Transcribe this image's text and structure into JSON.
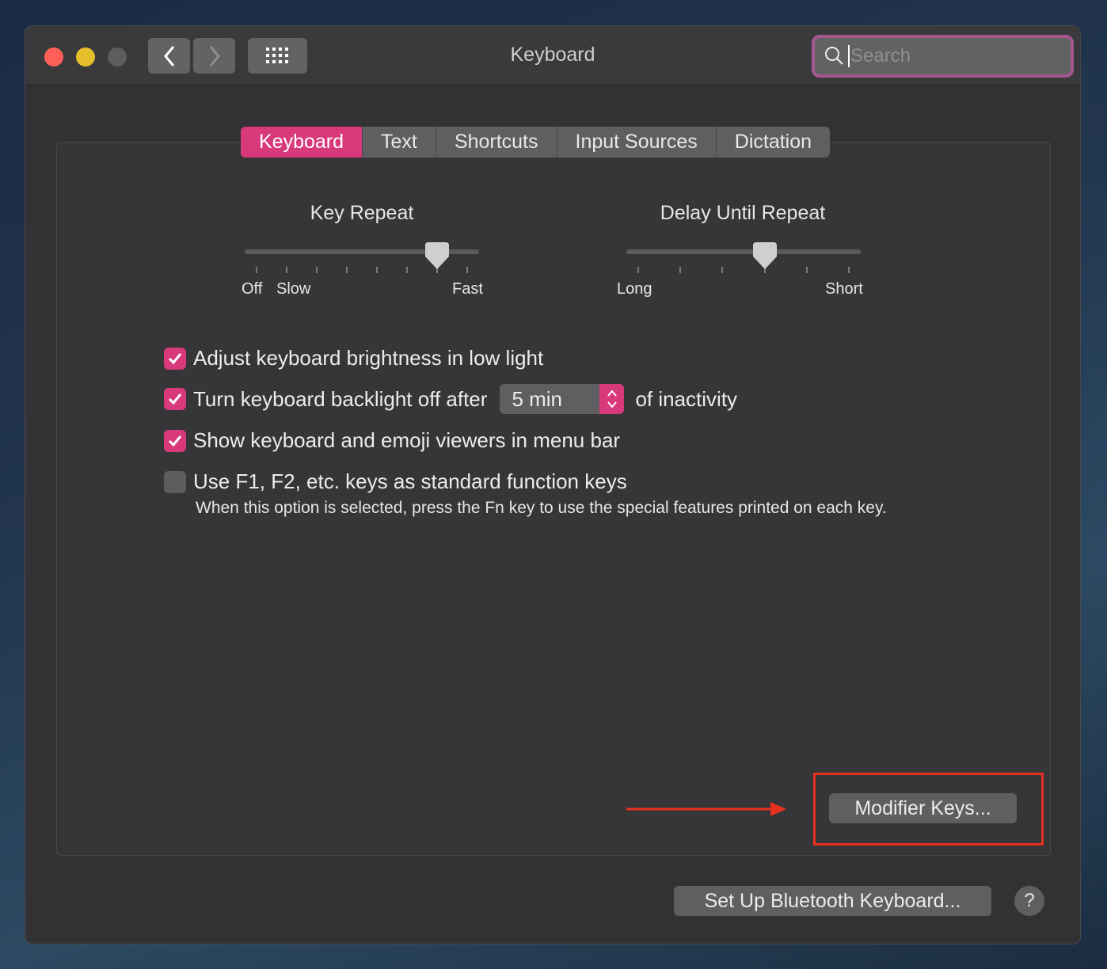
{
  "window": {
    "title": "Keyboard"
  },
  "search": {
    "placeholder": "Search",
    "value": ""
  },
  "tabs": [
    {
      "label": "Keyboard",
      "active": true
    },
    {
      "label": "Text",
      "active": false
    },
    {
      "label": "Shortcuts",
      "active": false
    },
    {
      "label": "Input Sources",
      "active": false
    },
    {
      "label": "Dictation",
      "active": false
    }
  ],
  "key_repeat": {
    "title": "Key Repeat",
    "labels": [
      "Off",
      "Slow",
      "Fast"
    ],
    "ticks": 8,
    "position": 6
  },
  "delay_until_repeat": {
    "title": "Delay Until Repeat",
    "labels": [
      "Long",
      "Short"
    ],
    "ticks": 6,
    "position": 3
  },
  "options": [
    {
      "label": "Adjust keyboard brightness in low light",
      "checked": true
    },
    {
      "label": "Turn keyboard backlight off after",
      "checked": true,
      "popup_value": "5 min",
      "suffix": "of inactivity"
    },
    {
      "label": "Show keyboard and emoji viewers in menu bar",
      "checked": true
    },
    {
      "label": "Use F1, F2, etc. keys as standard function keys",
      "checked": false
    }
  ],
  "fn_note": "When this option is selected, press the Fn key to use the special features printed on each key.",
  "buttons": {
    "modifier_keys": "Modifier Keys...",
    "bluetooth": "Set Up Bluetooth Keyboard...",
    "help": "?"
  },
  "colors": {
    "accent": "#d8397a",
    "annotation": "#e8301e",
    "search_ring": "#a6578f"
  }
}
